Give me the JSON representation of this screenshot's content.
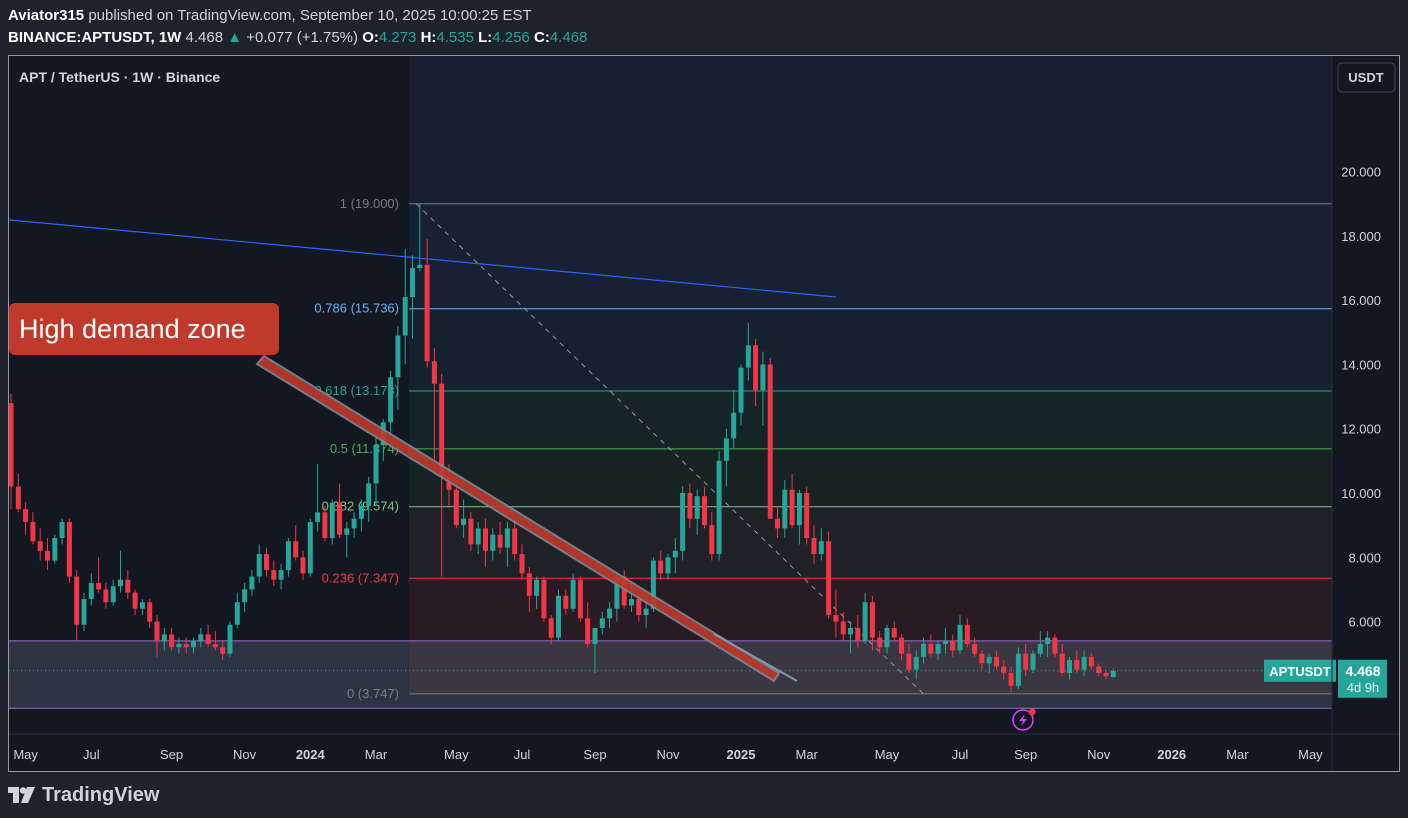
{
  "header": {
    "author": "Aviator315",
    "published_text": "published on TradingView.com, September 10, 2025 10:00:25 EST",
    "symbol": "BINANCE:APTUSDT, 1W",
    "last": "4.468",
    "change_arrow": "▲",
    "change": "+0.077 (+1.75%)",
    "o_label": "O:",
    "o": "4.273",
    "h_label": "H:",
    "h": "4.535",
    "l_label": "L:",
    "l": "4.256",
    "c_label": "C:",
    "c": "4.468"
  },
  "chart_data": {
    "type": "candlestick",
    "title": "APT / TetherUS · 1W · Binance",
    "currency_button": "USDT",
    "y_ticks": [
      "20.000",
      "18.000",
      "16.000",
      "14.000",
      "12.000",
      "10.000",
      "8.000",
      "6.000"
    ],
    "y_tick_values": [
      20,
      18,
      16,
      14,
      12,
      10,
      8,
      6
    ],
    "ylim": [
      2.5,
      23.6
    ],
    "x_ticks": [
      "May",
      "Jul",
      "Sep",
      "Nov",
      "2024",
      "Mar",
      "May",
      "Jul",
      "Sep",
      "Nov",
      "2025",
      "Mar",
      "May",
      "Jul",
      "Sep",
      "Nov",
      "2026",
      "Mar",
      "May"
    ],
    "x_tick_bold": [
      false,
      false,
      false,
      false,
      true,
      false,
      false,
      false,
      false,
      false,
      true,
      false,
      false,
      false,
      false,
      false,
      true,
      false,
      false
    ],
    "xlim_weeks": [
      0,
      176
    ],
    "fib_levels": [
      {
        "label": "1 (19.000)",
        "value": 19.0,
        "color": "#787b86"
      },
      {
        "label": "0.786 (15.736)",
        "value": 15.736,
        "color": "#64b5f6"
      },
      {
        "label": "0.618 (13.173)",
        "value": 13.173,
        "color": "#26a69a"
      },
      {
        "label": "0.5 (11.374)",
        "value": 11.374,
        "color": "#4caf50"
      },
      {
        "label": "0.382 (9.574)",
        "value": 9.574,
        "color": "#81c784"
      },
      {
        "label": "0.236 (7.347)",
        "value": 7.347,
        "color": "#f23645"
      },
      {
        "label": "0 (3.747)",
        "value": 3.747,
        "color": "#787b86"
      }
    ],
    "demand_zone": {
      "top": 5.4,
      "bottom": 3.3
    },
    "annotation": "High demand zone",
    "last_price_label": "APTUSDT",
    "last_price": "4.468",
    "countdown": "4d 9h",
    "candles_ohlc": [
      [
        12.8,
        13.1,
        9.5,
        10.2
      ],
      [
        10.2,
        10.6,
        9.4,
        9.5
      ],
      [
        9.5,
        9.7,
        8.7,
        9.1
      ],
      [
        9.1,
        9.4,
        8.4,
        8.5
      ],
      [
        8.5,
        8.9,
        7.9,
        8.2
      ],
      [
        8.2,
        8.6,
        7.6,
        7.9
      ],
      [
        7.9,
        8.7,
        7.8,
        8.6
      ],
      [
        8.6,
        9.2,
        8.4,
        9.1
      ],
      [
        9.1,
        9.2,
        7.2,
        7.4
      ],
      [
        7.4,
        7.6,
        5.4,
        5.9
      ],
      [
        5.9,
        6.9,
        5.7,
        6.7
      ],
      [
        6.7,
        7.5,
        6.5,
        7.2
      ],
      [
        7.2,
        8.0,
        6.9,
        7.0
      ],
      [
        7.0,
        7.2,
        6.4,
        6.6
      ],
      [
        6.6,
        7.3,
        6.5,
        7.1
      ],
      [
        7.1,
        8.2,
        6.9,
        7.3
      ],
      [
        7.3,
        7.6,
        6.7,
        6.9
      ],
      [
        6.9,
        7.0,
        6.2,
        6.4
      ],
      [
        6.4,
        6.7,
        6.2,
        6.6
      ],
      [
        6.6,
        6.7,
        5.8,
        6.0
      ],
      [
        6.0,
        6.2,
        4.9,
        5.4
      ],
      [
        5.4,
        5.8,
        5.1,
        5.6
      ],
      [
        5.6,
        5.8,
        5.1,
        5.2
      ],
      [
        5.2,
        5.5,
        5.0,
        5.3
      ],
      [
        5.3,
        5.5,
        5.0,
        5.2
      ],
      [
        5.2,
        5.5,
        5.0,
        5.4
      ],
      [
        5.4,
        5.8,
        5.2,
        5.6
      ],
      [
        5.6,
        5.9,
        5.2,
        5.3
      ],
      [
        5.3,
        5.7,
        5.1,
        5.2
      ],
      [
        5.2,
        5.4,
        4.8,
        5.0
      ],
      [
        5.0,
        6.0,
        4.9,
        5.9
      ],
      [
        5.9,
        6.9,
        5.8,
        6.6
      ],
      [
        6.6,
        7.2,
        6.3,
        7.0
      ],
      [
        7.0,
        7.6,
        6.8,
        7.4
      ],
      [
        7.4,
        8.4,
        7.2,
        8.1
      ],
      [
        8.1,
        8.3,
        7.4,
        7.6
      ],
      [
        7.6,
        7.9,
        7.1,
        7.3
      ],
      [
        7.3,
        7.8,
        7.0,
        7.6
      ],
      [
        7.6,
        8.6,
        7.4,
        8.5
      ],
      [
        8.5,
        9.0,
        7.9,
        8.0
      ],
      [
        8.0,
        8.2,
        7.3,
        7.5
      ],
      [
        7.5,
        9.2,
        7.4,
        9.1
      ],
      [
        9.1,
        10.9,
        8.8,
        9.4
      ],
      [
        9.4,
        9.6,
        8.5,
        8.6
      ],
      [
        8.6,
        9.8,
        8.4,
        9.7
      ],
      [
        9.7,
        10.3,
        8.6,
        8.7
      ],
      [
        8.7,
        9.1,
        8.0,
        8.9
      ],
      [
        8.9,
        9.4,
        8.6,
        9.2
      ],
      [
        9.2,
        9.8,
        8.8,
        9.6
      ],
      [
        9.6,
        10.5,
        9.1,
        10.3
      ],
      [
        10.3,
        11.8,
        9.6,
        11.5
      ],
      [
        11.5,
        12.3,
        11.0,
        12.2
      ],
      [
        12.2,
        13.8,
        11.8,
        13.6
      ],
      [
        13.6,
        15.2,
        12.6,
        14.9
      ],
      [
        14.9,
        17.6,
        14.0,
        16.1
      ],
      [
        16.1,
        17.4,
        14.8,
        17.0
      ],
      [
        17.0,
        19.0,
        16.9,
        17.1
      ],
      [
        17.1,
        17.9,
        13.9,
        14.1
      ],
      [
        14.1,
        14.5,
        10.9,
        13.4
      ],
      [
        13.4,
        13.7,
        7.4,
        10.5
      ],
      [
        10.5,
        10.9,
        9.6,
        10.1
      ],
      [
        10.1,
        10.4,
        8.9,
        9.0
      ],
      [
        9.0,
        9.8,
        8.6,
        9.2
      ],
      [
        9.2,
        9.4,
        8.2,
        8.4
      ],
      [
        8.4,
        9.1,
        8.1,
        8.9
      ],
      [
        8.9,
        9.2,
        7.7,
        8.2
      ],
      [
        8.2,
        8.9,
        7.9,
        8.7
      ],
      [
        8.7,
        9.1,
        8.1,
        8.3
      ],
      [
        8.3,
        9.1,
        7.7,
        8.9
      ],
      [
        8.9,
        9.2,
        7.9,
        8.1
      ],
      [
        8.1,
        8.4,
        7.3,
        7.5
      ],
      [
        7.5,
        7.7,
        6.3,
        6.8
      ],
      [
        6.8,
        7.4,
        6.4,
        7.3
      ],
      [
        7.3,
        7.4,
        6.0,
        6.1
      ],
      [
        6.1,
        6.2,
        5.3,
        5.5
      ],
      [
        5.5,
        7.0,
        5.4,
        6.8
      ],
      [
        6.8,
        7.0,
        6.2,
        6.4
      ],
      [
        6.4,
        7.5,
        6.3,
        7.3
      ],
      [
        7.3,
        7.4,
        6.0,
        6.1
      ],
      [
        6.1,
        6.6,
        5.2,
        5.3
      ],
      [
        5.3,
        5.8,
        4.4,
        5.8
      ],
      [
        5.8,
        6.3,
        5.6,
        6.1
      ],
      [
        6.1,
        6.6,
        5.8,
        6.4
      ],
      [
        6.4,
        7.5,
        6.0,
        7.4
      ],
      [
        7.4,
        7.6,
        6.4,
        6.5
      ],
      [
        6.5,
        7.2,
        6.3,
        6.7
      ],
      [
        6.7,
        7.0,
        6.0,
        6.2
      ],
      [
        6.2,
        6.9,
        5.8,
        6.4
      ],
      [
        6.4,
        8.0,
        6.3,
        7.9
      ],
      [
        7.9,
        8.2,
        7.3,
        7.5
      ],
      [
        7.5,
        8.1,
        7.3,
        8.0
      ],
      [
        8.0,
        8.6,
        7.5,
        8.2
      ],
      [
        8.2,
        10.2,
        7.9,
        10.0
      ],
      [
        10.0,
        10.3,
        8.9,
        9.2
      ],
      [
        9.2,
        10.1,
        8.7,
        9.9
      ],
      [
        9.9,
        10.2,
        8.9,
        9.0
      ],
      [
        9.0,
        9.4,
        7.9,
        8.1
      ],
      [
        8.1,
        11.3,
        7.9,
        11.0
      ],
      [
        11.0,
        12.0,
        10.2,
        11.7
      ],
      [
        11.7,
        13.2,
        11.4,
        12.5
      ],
      [
        12.5,
        14.0,
        12.1,
        13.9
      ],
      [
        13.9,
        15.3,
        13.5,
        14.6
      ],
      [
        14.6,
        14.8,
        12.7,
        13.2
      ],
      [
        13.2,
        14.4,
        12.1,
        14.0
      ],
      [
        14.0,
        14.2,
        9.8,
        9.2
      ],
      [
        9.2,
        9.6,
        8.6,
        8.9
      ],
      [
        8.9,
        10.4,
        8.6,
        10.1
      ],
      [
        10.1,
        10.6,
        8.9,
        9.0
      ],
      [
        9.0,
        10.1,
        8.4,
        10.0
      ],
      [
        10.0,
        10.2,
        8.4,
        8.6
      ],
      [
        8.6,
        9.0,
        7.8,
        8.1
      ],
      [
        8.1,
        8.9,
        7.9,
        8.5
      ],
      [
        8.5,
        8.8,
        6.1,
        6.2
      ],
      [
        6.2,
        7.0,
        5.5,
        6.0
      ],
      [
        6.0,
        6.3,
        5.4,
        5.6
      ],
      [
        5.6,
        6.0,
        5.0,
        5.8
      ],
      [
        5.8,
        6.2,
        5.2,
        5.4
      ],
      [
        5.4,
        6.9,
        5.3,
        6.6
      ],
      [
        6.6,
        6.8,
        5.1,
        5.5
      ],
      [
        5.5,
        5.7,
        5.0,
        5.2
      ],
      [
        5.2,
        5.9,
        5.0,
        5.8
      ],
      [
        5.8,
        6.0,
        5.4,
        5.5
      ],
      [
        5.5,
        5.6,
        4.8,
        5.0
      ],
      [
        5.0,
        5.3,
        4.4,
        4.5
      ],
      [
        4.5,
        5.1,
        4.2,
        4.9
      ],
      [
        4.9,
        5.5,
        4.7,
        5.3
      ],
      [
        5.3,
        5.6,
        4.9,
        5.0
      ],
      [
        5.0,
        5.4,
        4.8,
        5.3
      ],
      [
        5.3,
        5.8,
        5.0,
        5.4
      ],
      [
        5.4,
        5.6,
        4.9,
        5.1
      ],
      [
        5.1,
        6.2,
        5.0,
        5.9
      ],
      [
        5.9,
        6.1,
        5.2,
        5.3
      ],
      [
        5.3,
        5.5,
        4.9,
        5.0
      ],
      [
        5.0,
        5.1,
        4.5,
        4.7
      ],
      [
        4.7,
        5.0,
        4.4,
        4.9
      ],
      [
        4.9,
        5.1,
        4.5,
        4.6
      ],
      [
        4.6,
        4.8,
        4.2,
        4.4
      ],
      [
        4.4,
        4.6,
        3.8,
        4.0
      ],
      [
        4.0,
        5.2,
        3.9,
        5.0
      ],
      [
        5.0,
        5.3,
        4.3,
        4.5
      ],
      [
        4.5,
        5.1,
        4.4,
        5.0
      ],
      [
        5.0,
        5.7,
        4.9,
        5.3
      ],
      [
        5.3,
        5.7,
        4.9,
        5.5
      ],
      [
        5.5,
        5.6,
        4.9,
        5.0
      ],
      [
        5.0,
        5.3,
        4.3,
        4.4
      ],
      [
        4.4,
        4.9,
        4.2,
        4.8
      ],
      [
        4.8,
        5.1,
        4.4,
        4.5
      ],
      [
        4.5,
        5.1,
        4.3,
        4.9
      ],
      [
        4.9,
        5.0,
        4.5,
        4.6
      ],
      [
        4.6,
        4.7,
        4.3,
        4.4
      ],
      [
        4.4,
        4.5,
        4.2,
        4.3
      ],
      [
        4.273,
        4.535,
        4.256,
        4.468
      ]
    ]
  },
  "footer": {
    "brand": "TradingView"
  }
}
